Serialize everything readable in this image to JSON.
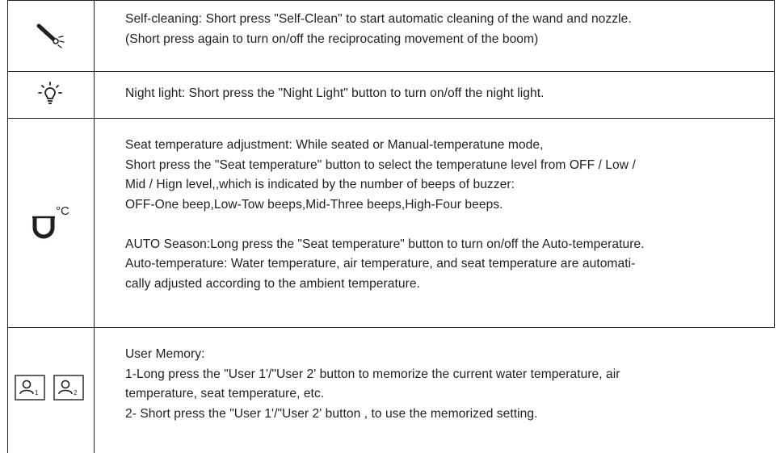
{
  "rows": {
    "self_clean": {
      "icon": "self-clean-wand-icon",
      "lines": [
        "Self-cleaning: Short press \"Self-Clean\" to start automatic cleaning of the wand and nozzle.",
        "(Short press again to turn on/off the reciprocating movement of the boom)"
      ]
    },
    "night_light": {
      "icon": "night-light-bulb-icon",
      "lines": [
        "Night light: Short press the \"Night Light\" button to turn on/off the night light."
      ]
    },
    "seat_temp": {
      "icon": "seat-temperature-icon",
      "icon_unit": "°C",
      "lines": [
        "Seat temperature adjustment: While seated or Manual-temperatune mode,",
        "Short press the \"Seat temperature\" button to select the temperatune level from OFF / Low /",
        "Mid / Hign level,,which is indicated by the number of  beeps of buzzer:",
        "OFF-One beep,Low-Tow beeps,Mid-Three beeps,High-Four beeps."
      ],
      "auto_lines": [
        "AUTO Season:Long press the \"Seat temperature\" button to turn on/off the Auto-temperature.",
        "Auto-temperature: Water temperature, air temperature, and seat temperature are automati-",
        "cally adjusted according to the ambient temperature."
      ]
    },
    "user_memory": {
      "icons": [
        {
          "name": "user-1-icon",
          "sub": "1"
        },
        {
          "name": "user-2-icon",
          "sub": "2"
        }
      ],
      "lines": [
        "User Memory:",
        "1-Long press the \"User 1'/\"User 2' button to memorize the current water temperature, air",
        "temperature, seat temperature, etc.",
        "2- Short press the \"User 1'/\"User 2' button , to use the memorized setting."
      ]
    }
  }
}
